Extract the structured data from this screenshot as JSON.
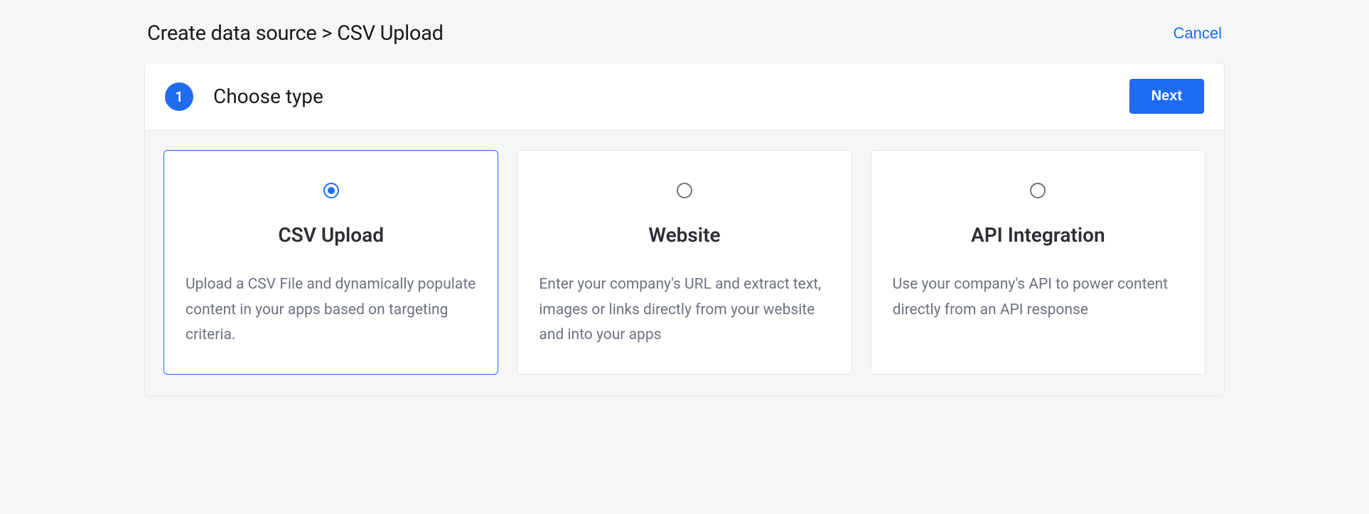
{
  "breadcrumb": "Create data source > CSV Upload",
  "cancel_label": "Cancel",
  "step": {
    "number": "1",
    "title": "Choose type",
    "next_label": "Next"
  },
  "options": [
    {
      "title": "CSV Upload",
      "description": "Upload a CSV File and dynamically populate content in your apps based on targeting criteria.",
      "selected": true
    },
    {
      "title": "Website",
      "description": "Enter your company's URL and extract text, images or links directly from your website and into your apps",
      "selected": false
    },
    {
      "title": "API Integration",
      "description": "Use your company's API to power content directly from an API response",
      "selected": false
    }
  ]
}
